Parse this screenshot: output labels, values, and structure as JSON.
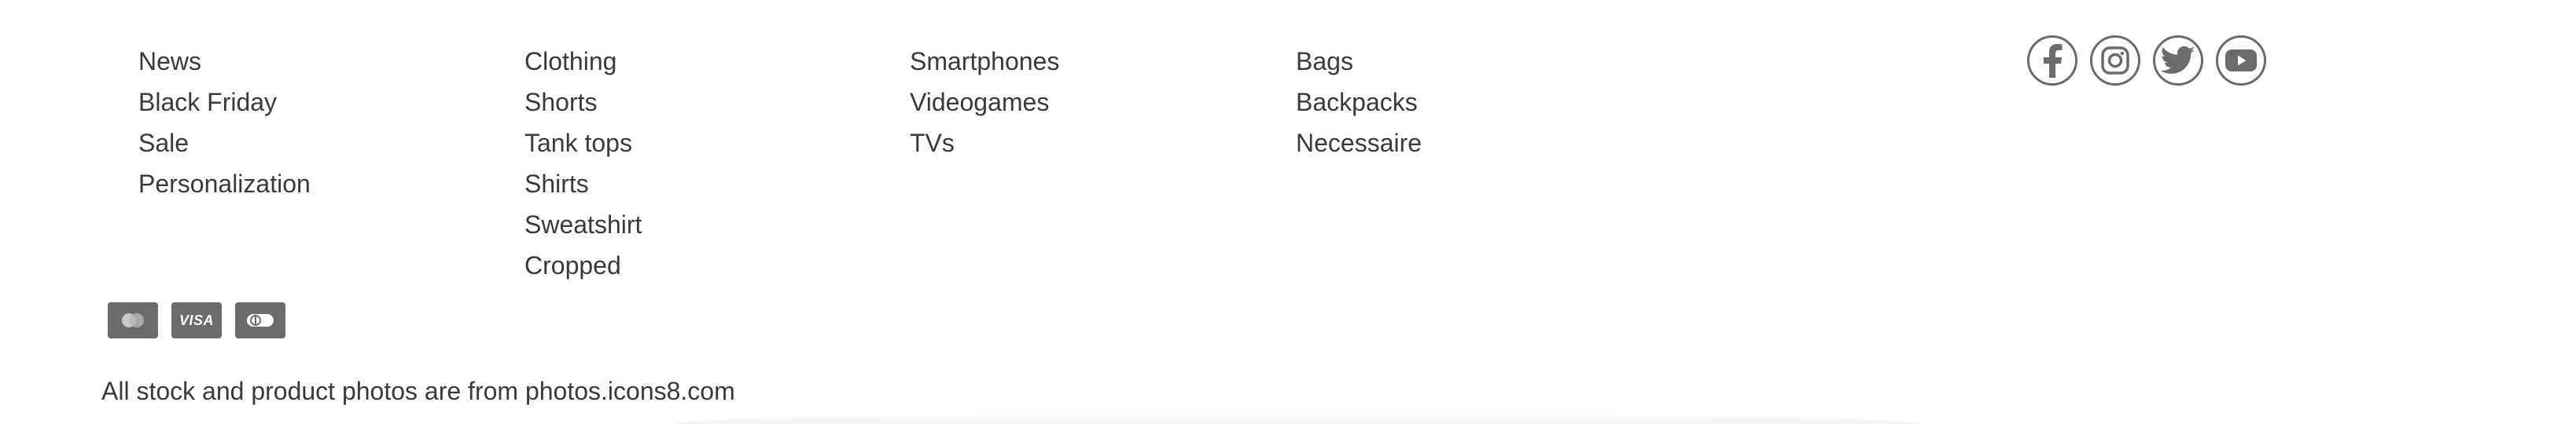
{
  "footer": {
    "columns": [
      {
        "links": [
          "News",
          "Black Friday",
          "Sale",
          "Personalization"
        ]
      },
      {
        "links": [
          "Clothing",
          "Shorts",
          "Tank tops",
          "Shirts",
          "Sweatshirt",
          "Cropped"
        ]
      },
      {
        "links": [
          "Smartphones",
          "Videogames",
          "TVs"
        ]
      },
      {
        "links": [
          "Bags",
          "Backpacks",
          "Necessaire"
        ]
      }
    ],
    "social": [
      {
        "icon": "facebook-icon"
      },
      {
        "icon": "instagram-icon"
      },
      {
        "icon": "twitter-icon"
      },
      {
        "icon": "youtube-icon"
      }
    ],
    "payments": [
      {
        "icon": "mastercard-icon"
      },
      {
        "icon": "visa-icon",
        "text": "VISA"
      },
      {
        "icon": "diners-club-icon"
      }
    ],
    "credit": "All stock and product photos are from photos.icons8.com"
  },
  "colors": {
    "text": "#3a3a3a",
    "icon": "#6b6b6b",
    "background": "#ffffff"
  }
}
